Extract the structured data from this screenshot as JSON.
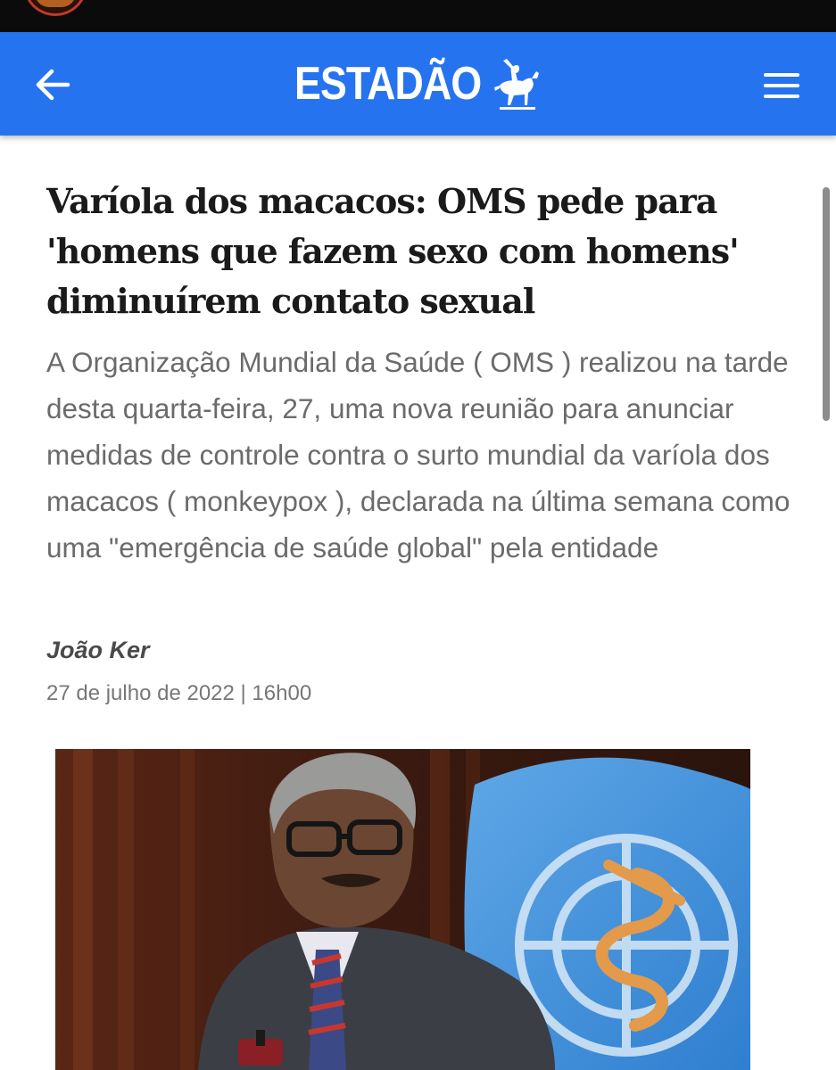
{
  "header": {
    "brand": "ESTADÃO",
    "accent_color": "#2673f0",
    "back_icon": "arrow-left-icon",
    "menu_icon": "hamburger-menu-icon",
    "logo_icon": "horse-rider-logo-icon"
  },
  "article": {
    "title": "Varíola dos macacos: OMS pede para 'homens que fazem sexo com homens' diminuírem contato sexual",
    "lead": "A Organização Mundial da Saúde ( OMS ) realizou na tarde desta quarta-feira, 27, uma nova reunião para anunciar medidas de controle contra o surto mundial da varíola dos macacos ( monkeypox ), declarada na última semana como uma \"emergência de saúde global\" pela entidade",
    "author": "João Ker",
    "date": "27 de julho de 2022 | 16h00"
  }
}
